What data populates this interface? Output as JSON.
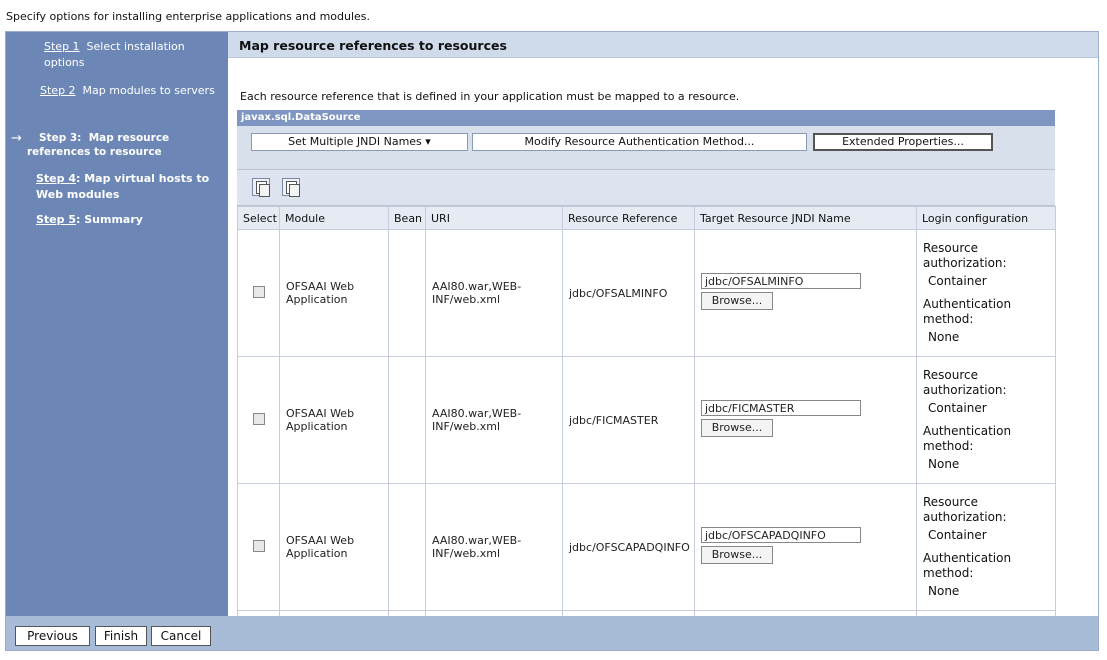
{
  "intro": "Specify options for installing enterprise applications and modules.",
  "steps": [
    {
      "link": "Step 1",
      "desc": "Select installation options"
    },
    {
      "link": "Step 2",
      "desc": "Map modules to servers"
    },
    {
      "link": "Step 3:",
      "desc": "Map resource references to resource",
      "current": true,
      "arrow": "→"
    },
    {
      "link": "Step 4",
      "desc": ": Map virtual hosts to Web modules"
    },
    {
      "link": "Step 5",
      "desc": ": Summary"
    }
  ],
  "panel": {
    "title": "Map resource references to resources",
    "instruction": "Each resource reference that is defined in your application must be mapped to a resource.",
    "datasource_label": "javax.sql.DataSource",
    "buttons": {
      "set_jndi": "Set Multiple JNDI Names ▾",
      "modify_auth": "Modify Resource Authentication Method...",
      "extended": "Extended Properties..."
    },
    "icons": [
      "select-all-icon",
      "deselect-all-icon"
    ]
  },
  "table": {
    "headers": [
      "Select",
      "Module",
      "Bean",
      "URI",
      "Resource Reference",
      "Target Resource JNDI Name",
      "Login configuration"
    ],
    "browse_label": "Browse...",
    "login": {
      "auth_label": "Resource authorization:",
      "auth_value": "Container",
      "method_label": "Authentication method:",
      "method_value": "None"
    },
    "rows": [
      {
        "module": "OFSAAI Web Application",
        "bean": "",
        "uri": "AAI80.war,WEB-INF/web.xml",
        "ref": "jdbc/OFSALMINFO",
        "jndi": "jdbc/OFSALMINFO"
      },
      {
        "module": "OFSAAI Web Application",
        "bean": "",
        "uri": "AAI80.war,WEB-INF/web.xml",
        "ref": "jdbc/FICMASTER",
        "jndi": "jdbc/FICMASTER"
      },
      {
        "module": "OFSAAI Web Application",
        "bean": "",
        "uri": "AAI80.war,WEB-INF/web.xml",
        "ref": "jdbc/OFSCAPADQINFO",
        "jndi": "jdbc/OFSCAPADQINFO"
      }
    ]
  },
  "footer": {
    "previous": "Previous",
    "finish": "Finish",
    "cancel": "Cancel"
  }
}
